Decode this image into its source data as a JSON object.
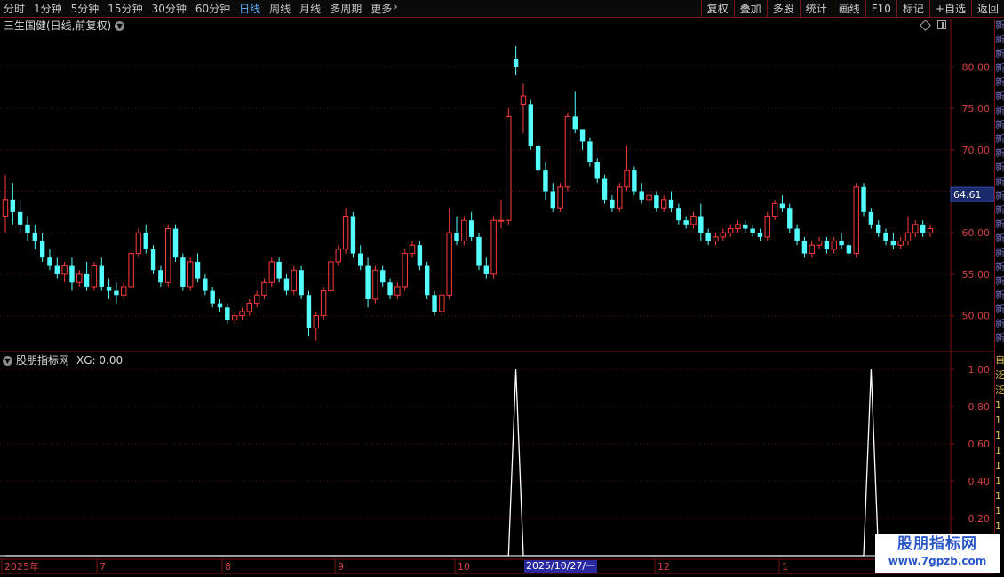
{
  "toolbar": {
    "periods": [
      {
        "label": "分时",
        "active": false
      },
      {
        "label": "1分钟",
        "active": false
      },
      {
        "label": "5分钟",
        "active": false
      },
      {
        "label": "15分钟",
        "active": false
      },
      {
        "label": "30分钟",
        "active": false
      },
      {
        "label": "60分钟",
        "active": false
      },
      {
        "label": "日线",
        "active": true
      },
      {
        "label": "周线",
        "active": false
      },
      {
        "label": "月线",
        "active": false
      },
      {
        "label": "多周期",
        "active": false
      },
      {
        "label": "更多",
        "active": false
      }
    ],
    "tools": [
      "复权",
      "叠加",
      "多股",
      "统计",
      "画线",
      "F10",
      "标记",
      "+自选",
      "返回"
    ]
  },
  "price_panel": {
    "title": "三生国健(日线,前复权)",
    "current_price_label": "64.61",
    "y_ticks": [
      "80.00",
      "75.00",
      "70.00",
      "65.00",
      "60.00",
      "55.00",
      "50.00"
    ]
  },
  "indicator_panel": {
    "title": "股朋指标网",
    "value_text": "XG: 0.00",
    "y_ticks": [
      "1.00",
      "0.80",
      "0.60",
      "0.40",
      "0.20"
    ]
  },
  "x_axis": {
    "labels": [
      "2025年",
      "7",
      "8",
      "9",
      "10",
      "12",
      "1"
    ],
    "cursor_label": "2025/10/27/一"
  },
  "side_strip": {
    "upper": [
      "新",
      "新",
      "新",
      "新",
      "新",
      "新",
      "新",
      "新",
      "新",
      "新",
      "新",
      "新",
      "新",
      "新",
      "新",
      "新",
      "新",
      "新",
      "新",
      "新",
      "新",
      "新",
      "新"
    ],
    "lower": [
      "自",
      "泛",
      "泛",
      "1",
      "1",
      "1",
      "1",
      "1",
      "1",
      "1",
      "1",
      "1"
    ]
  },
  "watermark": {
    "main": "股朋指标网",
    "sub": "www.7gpzb.com"
  },
  "colors": {
    "up": "#ff3b3b",
    "down": "#54ffff",
    "axis": "#7a1515",
    "grid": "#5a1010",
    "indicator": "#ffffff"
  },
  "chart_data": {
    "type": "candlestick",
    "ylim": [
      46,
      84
    ],
    "indicator_ylim": [
      0,
      1
    ],
    "candles": [
      {
        "o": 62.0,
        "h": 67.0,
        "l": 60.0,
        "c": 64.0
      },
      {
        "o": 64.0,
        "h": 66.0,
        "l": 61.0,
        "c": 62.5
      },
      {
        "o": 62.5,
        "h": 64.0,
        "l": 60.0,
        "c": 61.0
      },
      {
        "o": 61.0,
        "h": 62.0,
        "l": 59.0,
        "c": 60.0
      },
      {
        "o": 60.0,
        "h": 61.0,
        "l": 58.0,
        "c": 59.0
      },
      {
        "o": 59.0,
        "h": 60.0,
        "l": 56.5,
        "c": 57.0
      },
      {
        "o": 57.0,
        "h": 58.0,
        "l": 55.5,
        "c": 56.0
      },
      {
        "o": 56.0,
        "h": 57.0,
        "l": 54.5,
        "c": 55.0
      },
      {
        "o": 55.0,
        "h": 56.5,
        "l": 54.0,
        "c": 56.0
      },
      {
        "o": 56.0,
        "h": 57.0,
        "l": 53.0,
        "c": 54.0
      },
      {
        "o": 54.0,
        "h": 55.5,
        "l": 53.5,
        "c": 55.0
      },
      {
        "o": 55.0,
        "h": 56.5,
        "l": 53.0,
        "c": 53.5
      },
      {
        "o": 53.5,
        "h": 56.5,
        "l": 53.0,
        "c": 56.0
      },
      {
        "o": 56.0,
        "h": 57.0,
        "l": 53.0,
        "c": 53.5
      },
      {
        "o": 53.5,
        "h": 54.5,
        "l": 52.0,
        "c": 53.0
      },
      {
        "o": 53.0,
        "h": 54.0,
        "l": 51.5,
        "c": 52.5
      },
      {
        "o": 52.5,
        "h": 54.0,
        "l": 52.0,
        "c": 53.5
      },
      {
        "o": 53.5,
        "h": 58.0,
        "l": 53.0,
        "c": 57.5
      },
      {
        "o": 57.5,
        "h": 60.5,
        "l": 57.0,
        "c": 60.0
      },
      {
        "o": 60.0,
        "h": 61.0,
        "l": 57.5,
        "c": 58.0
      },
      {
        "o": 58.0,
        "h": 58.5,
        "l": 55.0,
        "c": 55.5
      },
      {
        "o": 55.5,
        "h": 56.0,
        "l": 53.5,
        "c": 54.0
      },
      {
        "o": 54.0,
        "h": 61.0,
        "l": 53.5,
        "c": 60.5
      },
      {
        "o": 60.5,
        "h": 61.0,
        "l": 56.5,
        "c": 57.0
      },
      {
        "o": 57.0,
        "h": 57.5,
        "l": 53.0,
        "c": 53.5
      },
      {
        "o": 53.5,
        "h": 57.0,
        "l": 53.0,
        "c": 56.5
      },
      {
        "o": 56.5,
        "h": 57.5,
        "l": 54.0,
        "c": 54.5
      },
      {
        "o": 54.5,
        "h": 55.0,
        "l": 52.5,
        "c": 53.0
      },
      {
        "o": 53.0,
        "h": 53.5,
        "l": 51.0,
        "c": 51.5
      },
      {
        "o": 51.5,
        "h": 52.0,
        "l": 50.5,
        "c": 51.0
      },
      {
        "o": 51.0,
        "h": 51.5,
        "l": 49.0,
        "c": 49.5
      },
      {
        "o": 49.5,
        "h": 50.5,
        "l": 49.0,
        "c": 50.0
      },
      {
        "o": 50.0,
        "h": 51.0,
        "l": 49.5,
        "c": 50.5
      },
      {
        "o": 50.5,
        "h": 52.0,
        "l": 50.0,
        "c": 51.5
      },
      {
        "o": 51.5,
        "h": 53.0,
        "l": 51.0,
        "c": 52.5
      },
      {
        "o": 52.5,
        "h": 54.5,
        "l": 52.0,
        "c": 54.0
      },
      {
        "o": 54.0,
        "h": 57.0,
        "l": 53.5,
        "c": 56.5
      },
      {
        "o": 56.5,
        "h": 57.0,
        "l": 54.0,
        "c": 54.5
      },
      {
        "o": 54.5,
        "h": 55.0,
        "l": 52.5,
        "c": 53.0
      },
      {
        "o": 53.0,
        "h": 56.0,
        "l": 52.5,
        "c": 55.5
      },
      {
        "o": 55.5,
        "h": 56.0,
        "l": 52.0,
        "c": 52.5
      },
      {
        "o": 52.5,
        "h": 53.0,
        "l": 47.5,
        "c": 48.5
      },
      {
        "o": 48.5,
        "h": 50.5,
        "l": 47.0,
        "c": 50.0
      },
      {
        "o": 50.0,
        "h": 53.5,
        "l": 49.5,
        "c": 53.0
      },
      {
        "o": 53.0,
        "h": 57.0,
        "l": 52.5,
        "c": 56.5
      },
      {
        "o": 56.5,
        "h": 58.5,
        "l": 56.0,
        "c": 58.0
      },
      {
        "o": 58.0,
        "h": 63.0,
        "l": 57.5,
        "c": 62.0
      },
      {
        "o": 62.0,
        "h": 62.5,
        "l": 57.0,
        "c": 57.5
      },
      {
        "o": 57.5,
        "h": 58.5,
        "l": 55.5,
        "c": 56.0
      },
      {
        "o": 56.0,
        "h": 57.0,
        "l": 51.0,
        "c": 52.0
      },
      {
        "o": 52.0,
        "h": 56.0,
        "l": 51.5,
        "c": 55.5
      },
      {
        "o": 55.5,
        "h": 56.0,
        "l": 53.5,
        "c": 54.0
      },
      {
        "o": 54.0,
        "h": 54.5,
        "l": 52.0,
        "c": 52.5
      },
      {
        "o": 52.5,
        "h": 54.0,
        "l": 52.0,
        "c": 53.5
      },
      {
        "o": 53.5,
        "h": 58.0,
        "l": 53.0,
        "c": 57.5
      },
      {
        "o": 57.5,
        "h": 59.0,
        "l": 57.0,
        "c": 58.5
      },
      {
        "o": 58.5,
        "h": 59.0,
        "l": 55.5,
        "c": 56.0
      },
      {
        "o": 56.0,
        "h": 56.5,
        "l": 52.0,
        "c": 52.5
      },
      {
        "o": 52.5,
        "h": 53.0,
        "l": 50.0,
        "c": 50.5
      },
      {
        "o": 50.5,
        "h": 53.0,
        "l": 50.0,
        "c": 52.5
      },
      {
        "o": 52.5,
        "h": 63.0,
        "l": 52.0,
        "c": 60.0
      },
      {
        "o": 60.0,
        "h": 62.0,
        "l": 58.5,
        "c": 59.0
      },
      {
        "o": 59.0,
        "h": 62.0,
        "l": 58.5,
        "c": 61.5
      },
      {
        "o": 61.5,
        "h": 62.5,
        "l": 59.0,
        "c": 59.5
      },
      {
        "o": 59.5,
        "h": 60.0,
        "l": 55.5,
        "c": 56.0
      },
      {
        "o": 56.0,
        "h": 57.0,
        "l": 54.5,
        "c": 55.0
      },
      {
        "o": 55.0,
        "h": 62.0,
        "l": 54.5,
        "c": 61.5
      },
      {
        "o": 61.5,
        "h": 64.0,
        "l": 60.5,
        "c": 61.5
      },
      {
        "o": 61.5,
        "h": 75.0,
        "l": 61.0,
        "c": 74.0
      },
      {
        "o": 81.0,
        "h": 82.5,
        "l": 79.0,
        "c": 80.0
      },
      {
        "o": 75.5,
        "h": 78.0,
        "l": 72.0,
        "c": 76.5
      },
      {
        "o": 75.5,
        "h": 76.0,
        "l": 70.0,
        "c": 70.5
      },
      {
        "o": 70.5,
        "h": 71.0,
        "l": 67.0,
        "c": 67.5
      },
      {
        "o": 67.5,
        "h": 68.5,
        "l": 64.0,
        "c": 65.0
      },
      {
        "o": 65.0,
        "h": 66.0,
        "l": 62.5,
        "c": 63.0
      },
      {
        "o": 63.0,
        "h": 66.0,
        "l": 62.5,
        "c": 65.5
      },
      {
        "o": 65.5,
        "h": 74.5,
        "l": 65.0,
        "c": 74.0
      },
      {
        "o": 74.0,
        "h": 77.0,
        "l": 72.0,
        "c": 72.5
      },
      {
        "o": 72.5,
        "h": 72.5,
        "l": 70.0,
        "c": 71.0
      },
      {
        "o": 71.0,
        "h": 71.5,
        "l": 68.0,
        "c": 68.5
      },
      {
        "o": 68.5,
        "h": 69.0,
        "l": 66.0,
        "c": 66.5
      },
      {
        "o": 66.5,
        "h": 67.0,
        "l": 63.5,
        "c": 64.0
      },
      {
        "o": 64.0,
        "h": 64.5,
        "l": 62.5,
        "c": 63.0
      },
      {
        "o": 63.0,
        "h": 66.0,
        "l": 62.5,
        "c": 65.5
      },
      {
        "o": 65.5,
        "h": 70.5,
        "l": 65.0,
        "c": 67.5
      },
      {
        "o": 67.5,
        "h": 68.0,
        "l": 64.5,
        "c": 65.0
      },
      {
        "o": 65.0,
        "h": 66.0,
        "l": 63.5,
        "c": 64.0
      },
      {
        "o": 64.0,
        "h": 65.0,
        "l": 63.0,
        "c": 64.5
      },
      {
        "o": 64.5,
        "h": 65.0,
        "l": 62.5,
        "c": 63.0
      },
      {
        "o": 63.0,
        "h": 64.5,
        "l": 62.5,
        "c": 64.0
      },
      {
        "o": 64.0,
        "h": 65.0,
        "l": 62.5,
        "c": 63.0
      },
      {
        "o": 63.0,
        "h": 63.5,
        "l": 61.0,
        "c": 61.5
      },
      {
        "o": 61.5,
        "h": 62.0,
        "l": 60.5,
        "c": 61.0
      },
      {
        "o": 61.0,
        "h": 62.5,
        "l": 60.5,
        "c": 62.0
      },
      {
        "o": 62.0,
        "h": 63.5,
        "l": 59.0,
        "c": 60.0
      },
      {
        "o": 60.0,
        "h": 60.5,
        "l": 58.5,
        "c": 59.0
      },
      {
        "o": 59.0,
        "h": 60.0,
        "l": 58.5,
        "c": 59.5
      },
      {
        "o": 59.5,
        "h": 60.5,
        "l": 59.0,
        "c": 60.0
      },
      {
        "o": 60.0,
        "h": 61.0,
        "l": 59.5,
        "c": 60.5
      },
      {
        "o": 60.5,
        "h": 61.5,
        "l": 60.0,
        "c": 61.0
      },
      {
        "o": 61.0,
        "h": 61.5,
        "l": 60.0,
        "c": 60.5
      },
      {
        "o": 60.5,
        "h": 61.0,
        "l": 59.5,
        "c": 60.0
      },
      {
        "o": 60.0,
        "h": 60.5,
        "l": 59.0,
        "c": 59.5
      },
      {
        "o": 59.5,
        "h": 62.5,
        "l": 59.0,
        "c": 62.0
      },
      {
        "o": 62.0,
        "h": 64.0,
        "l": 61.5,
        "c": 63.5
      },
      {
        "o": 63.5,
        "h": 64.5,
        "l": 62.5,
        "c": 63.0
      },
      {
        "o": 63.0,
        "h": 63.5,
        "l": 60.0,
        "c": 60.5
      },
      {
        "o": 60.5,
        "h": 61.0,
        "l": 58.5,
        "c": 59.0
      },
      {
        "o": 59.0,
        "h": 59.5,
        "l": 57.0,
        "c": 57.5
      },
      {
        "o": 57.5,
        "h": 59.0,
        "l": 57.0,
        "c": 58.5
      },
      {
        "o": 58.5,
        "h": 59.5,
        "l": 58.0,
        "c": 59.0
      },
      {
        "o": 59.0,
        "h": 59.5,
        "l": 57.5,
        "c": 58.0
      },
      {
        "o": 58.0,
        "h": 59.5,
        "l": 57.5,
        "c": 59.0
      },
      {
        "o": 59.0,
        "h": 60.0,
        "l": 58.0,
        "c": 58.5
      },
      {
        "o": 58.5,
        "h": 59.0,
        "l": 57.0,
        "c": 57.5
      },
      {
        "o": 57.5,
        "h": 66.0,
        "l": 57.0,
        "c": 65.5
      },
      {
        "o": 65.5,
        "h": 66.0,
        "l": 62.0,
        "c": 62.5
      },
      {
        "o": 62.5,
        "h": 63.0,
        "l": 60.5,
        "c": 61.0
      },
      {
        "o": 61.0,
        "h": 61.5,
        "l": 59.5,
        "c": 60.0
      },
      {
        "o": 60.0,
        "h": 60.5,
        "l": 58.5,
        "c": 59.0
      },
      {
        "o": 59.0,
        "h": 60.0,
        "l": 58.0,
        "c": 58.5
      },
      {
        "o": 58.5,
        "h": 59.5,
        "l": 58.0,
        "c": 59.0
      },
      {
        "o": 59.0,
        "h": 62.0,
        "l": 58.5,
        "c": 60.0
      },
      {
        "o": 60.0,
        "h": 61.5,
        "l": 59.5,
        "c": 61.0
      },
      {
        "o": 61.0,
        "h": 61.5,
        "l": 59.5,
        "c": 60.0
      },
      {
        "o": 60.0,
        "h": 61.0,
        "l": 59.5,
        "c": 60.5
      }
    ],
    "signals": [
      69,
      117
    ]
  }
}
